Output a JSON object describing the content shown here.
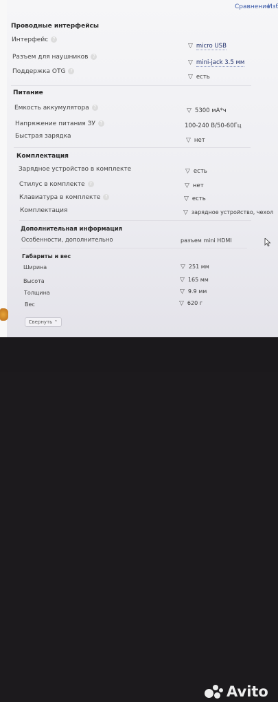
{
  "topbar": {
    "compare_label": "Сравнение",
    "favorites_label": "Изб"
  },
  "sections": {
    "interfaces": {
      "title": "Проводные интерфейсы",
      "rows": [
        {
          "label": "Интерфейс",
          "value": "micro USB"
        },
        {
          "label": "Разъем для наушников",
          "value": "mini-jack 3.5 мм"
        },
        {
          "label": "Поддержка OTG",
          "value": "есть"
        }
      ]
    },
    "power": {
      "title": "Питание",
      "rows": [
        {
          "label": "Емкость аккумулятора",
          "value": "5300 мА*ч"
        },
        {
          "label": "Напряжение питания ЗУ",
          "value": "100-240 В/50-60Гц"
        },
        {
          "label": "Быстрая зарядка",
          "value": "нет"
        }
      ]
    },
    "kit": {
      "title": "Комплектация",
      "rows": [
        {
          "label": "Зарядное устройство в комплекте",
          "value": "есть"
        },
        {
          "label": "Стилус в комплекте",
          "value": "нет"
        },
        {
          "label": "Клавиатура в комплекте",
          "value": "есть"
        },
        {
          "label": "Комплектация",
          "value": "зарядное устройство, чехол"
        }
      ]
    },
    "extra": {
      "title": "Дополнительная информация",
      "rows": [
        {
          "label": "Особенности, дополнительно",
          "value": "разъем mini HDMI"
        }
      ]
    },
    "dimensions": {
      "title": "Габариты и вес",
      "rows": [
        {
          "label": "Ширина",
          "value": "251 мм"
        },
        {
          "label": "Высота",
          "value": "165 мм"
        },
        {
          "label": "Толщина",
          "value": "9.9 мм"
        },
        {
          "label": "Вес",
          "value": "620 г"
        }
      ]
    }
  },
  "collapse_button_label": "Свернуть",
  "watermark": {
    "brand": "Avito"
  },
  "icons": {
    "help": "question-icon",
    "check": "check-icon",
    "cursor": "mouse-cursor-icon"
  }
}
